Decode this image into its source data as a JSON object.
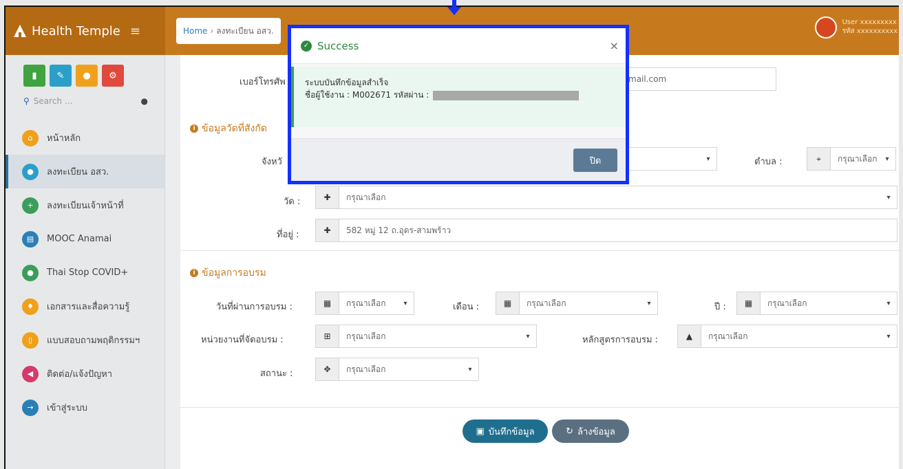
{
  "topbar": {
    "brand": "Health Temple",
    "breadcrumb": {
      "home": "Home",
      "sep": "›",
      "current": "ลงทะเบียน อสว."
    },
    "user": {
      "line1": "User xxxxxxxxx",
      "line2": "รหัส xxxxxxxxxx"
    }
  },
  "sidebar": {
    "search_placeholder": "Search ...",
    "quick_buttons": [
      {
        "icon": "bar-chart-icon",
        "color": "#3fa33f"
      },
      {
        "icon": "edit-icon",
        "color": "#2aa0c9"
      },
      {
        "icon": "users-icon",
        "color": "#f0a11b"
      },
      {
        "icon": "settings-icon",
        "color": "#e0493b"
      }
    ],
    "items": [
      {
        "label": "หน้าหลัก",
        "icon": "home-icon",
        "color": "#f0a11b"
      },
      {
        "label": "ลงทะเบียน อสว.",
        "icon": "users-icon",
        "color": "#2aa0c9",
        "active": true
      },
      {
        "label": "ลงทะเบียนเจ้าหน้าที่",
        "icon": "user-plus-icon",
        "color": "#3a9e5a"
      },
      {
        "label": "MOOC Anamai",
        "icon": "book-icon",
        "color": "#2a7fb5"
      },
      {
        "label": "Thai Stop COVID+",
        "icon": "user-icon",
        "color": "#3a9e5a"
      },
      {
        "label": "เอกสารและสื่อความรู้",
        "icon": "lightbulb-icon",
        "color": "#f0a11b"
      },
      {
        "label": "แบบสอบถามพฤติกรรมฯ",
        "icon": "document-icon",
        "color": "#f0a11b"
      },
      {
        "label": "ติดต่อ/แจ้งปัญหา",
        "icon": "megaphone-icon",
        "color": "#d63a6b"
      },
      {
        "label": "เข้าสู่ระบบ",
        "icon": "login-icon",
        "color": "#2a7fb5"
      }
    ]
  },
  "form": {
    "phone_label": "เบอร์โทรศัพ",
    "email_value": "mail.com",
    "section_temple": "ข้อมูลวัดที่สังกัด",
    "province_label": "จังหวั",
    "subdistrict_label": "ตำบล :",
    "subdistrict_value": "กรุณาเลือก",
    "temple_label": "วัด :",
    "temple_value": "กรุณาเลือก",
    "address_label": "ที่อยู่ :",
    "address_value": "582 หมู่ 12 ถ.อุดร-สามพร้าว",
    "section_training": "ข้อมูลการอบรม",
    "day_label": "วันที่ผ่านการอบรม :",
    "day_value": "กรุณาเลือก",
    "month_label": "เดือน :",
    "month_value": "กรุณาเลือก",
    "year_label": "ปี :",
    "year_value": "กรุณาเลือก",
    "org_label": "หน่วยงานที่จัดอบรม :",
    "org_value": "กรุณาเลือก",
    "course_label": "หลักสูตรการอบรม :",
    "course_value": "กรุณาเลือก",
    "status_label": "สถานะ :",
    "status_value": "กรุณาเลือก",
    "save_button": "บันทึกข้อมูล",
    "clear_button": "ล้างข้อมูล"
  },
  "modal": {
    "title": "Success",
    "line1": "ระบบบันทึกข้อมูลสำเร็จ",
    "line2": "ชื่อผู้ใช้งาน : M002671 รหัสผ่าน :",
    "close_button": "ปิด",
    "highlight_color": "#1430ff"
  }
}
